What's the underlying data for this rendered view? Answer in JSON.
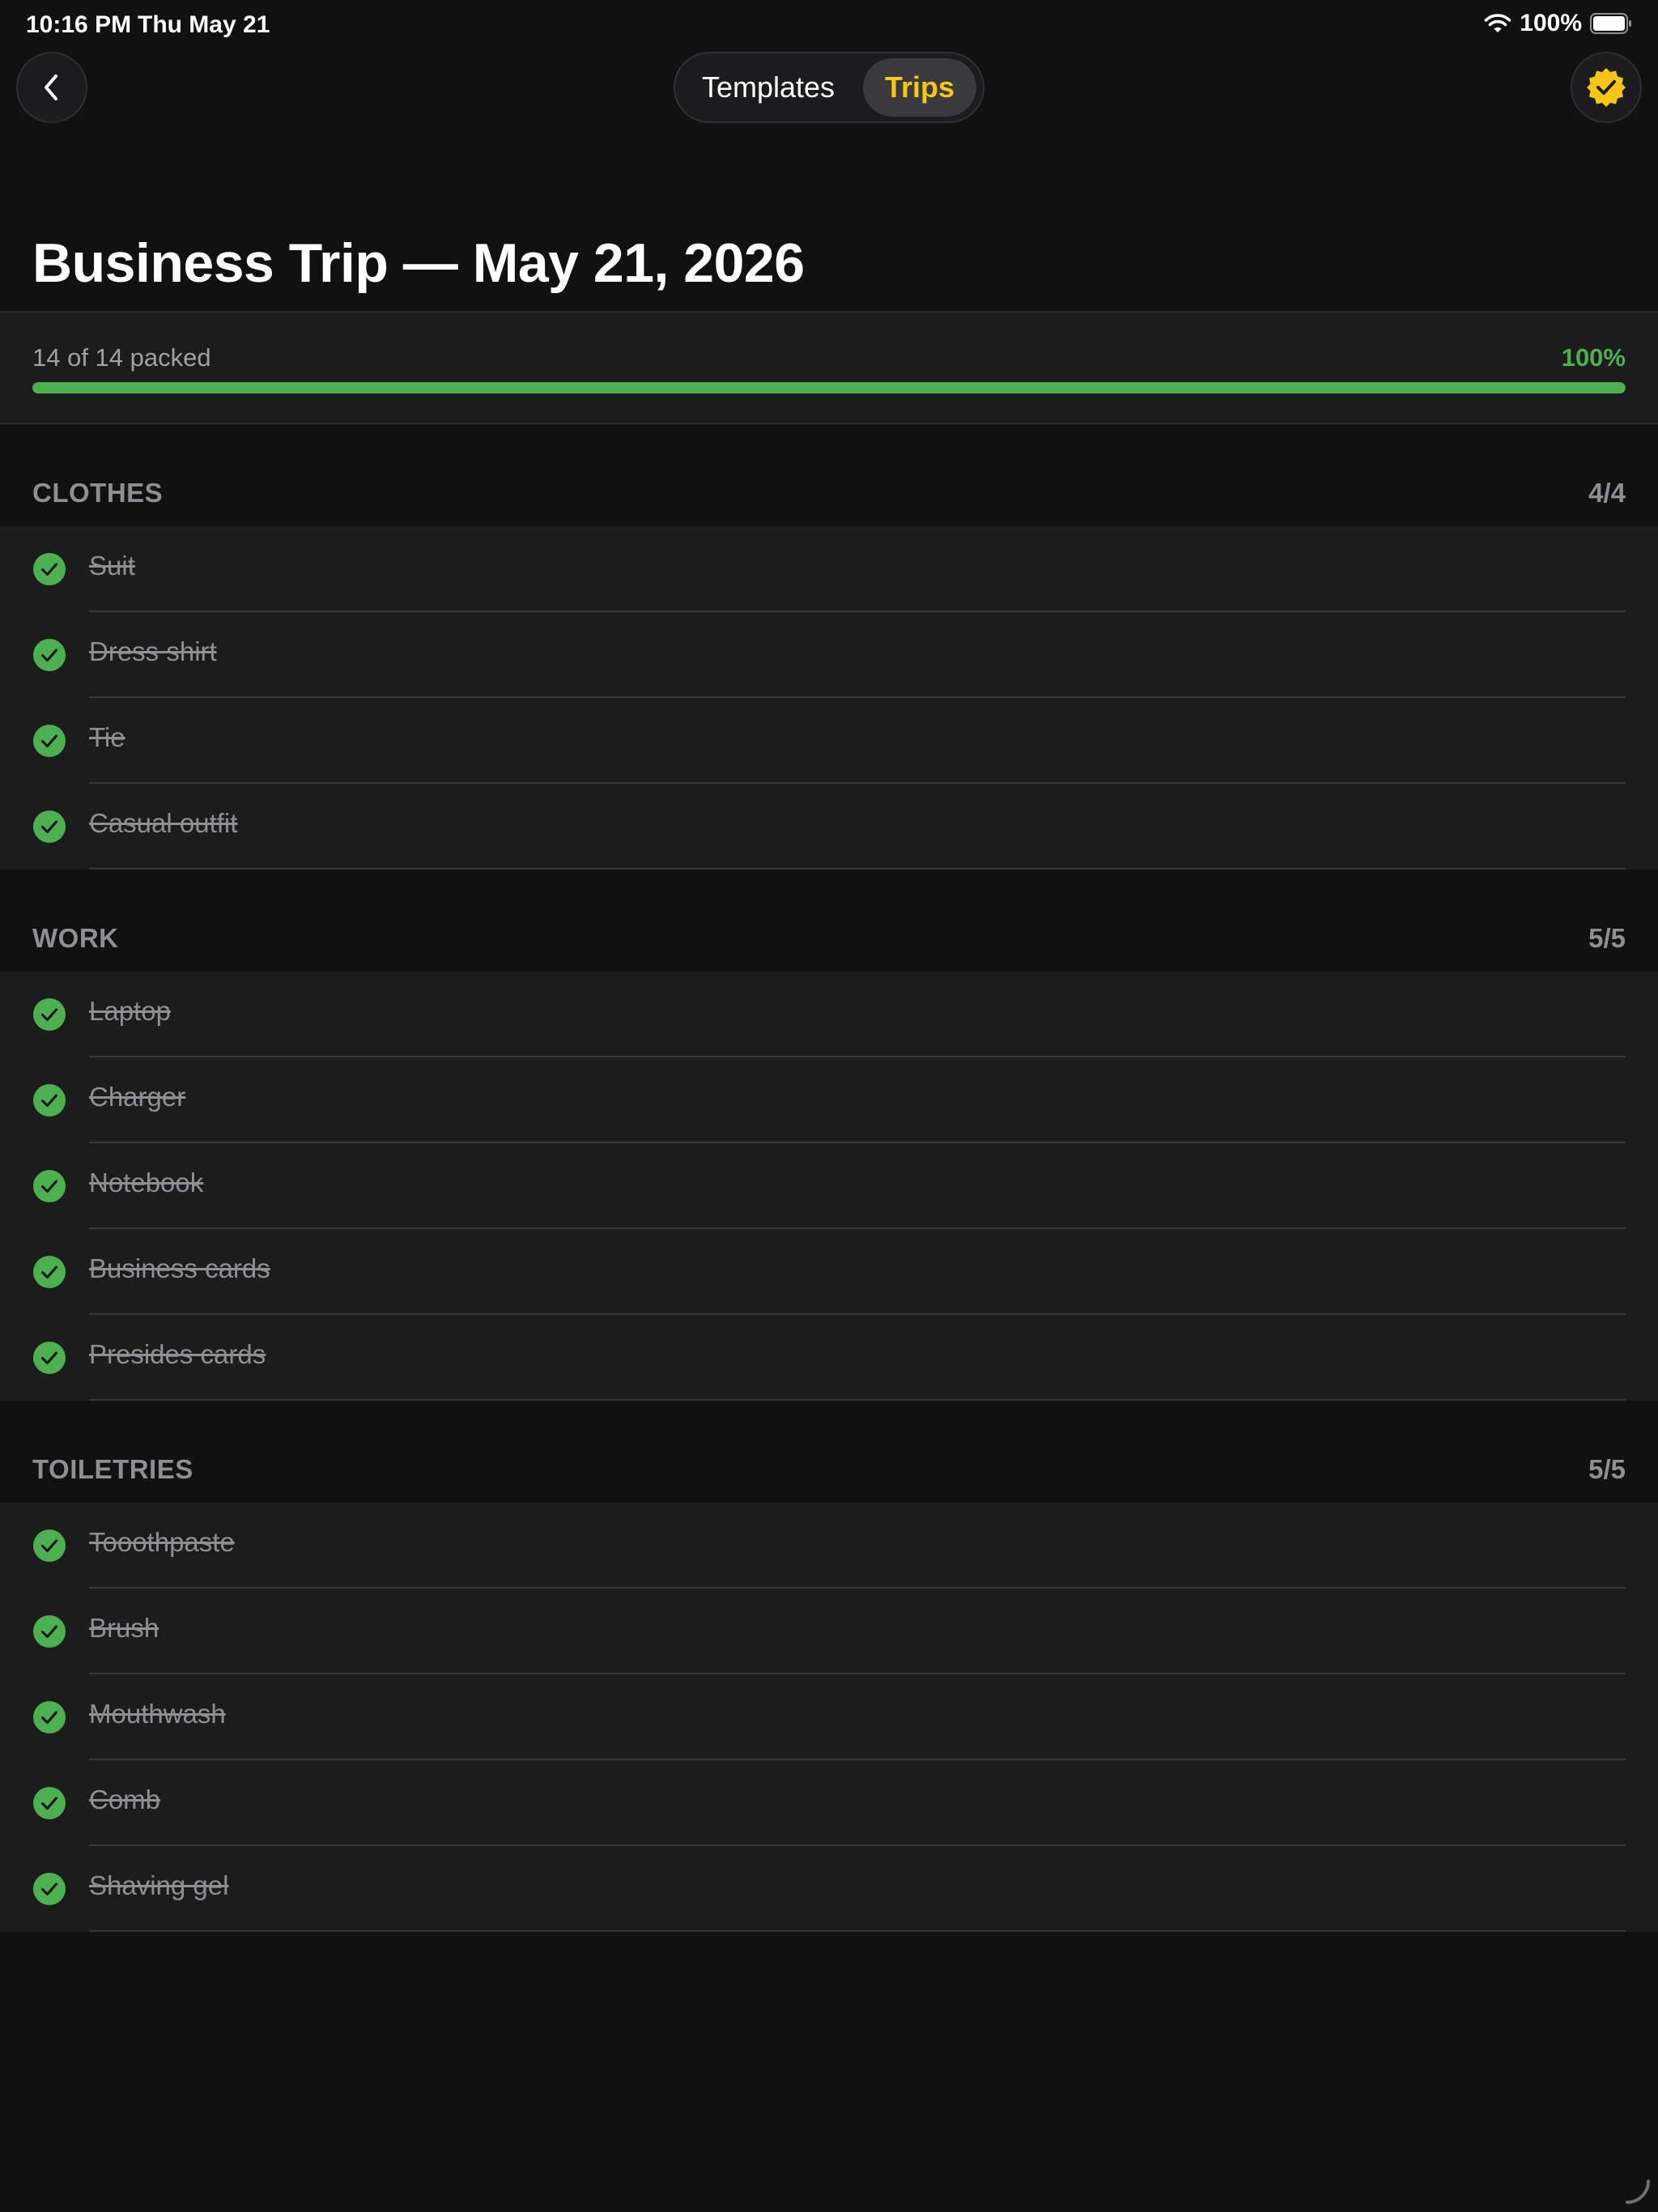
{
  "status_bar": {
    "time": "10:16 PM",
    "date": "Thu May 21",
    "battery_percent": "100%",
    "battery_level": 1.0
  },
  "nav": {
    "back_icon": "chevron-left-icon",
    "segments": [
      {
        "label": "Templates",
        "selected": false
      },
      {
        "label": "Trips",
        "selected": true
      }
    ],
    "badge_icon": "checkmark-seal-icon"
  },
  "page": {
    "title": "Business Trip — May 21, 2026"
  },
  "progress": {
    "text": "14 of 14 packed",
    "percent_label": "100%",
    "fraction": 1.0
  },
  "sections": [
    {
      "title": "CLOTHES",
      "count": "4/4",
      "items": [
        "Suit",
        "Dress shirt",
        "Tie",
        "Casual outfit"
      ]
    },
    {
      "title": "WORK",
      "count": "5/5",
      "items": [
        "Laptop",
        "Charger",
        "Notebook",
        "Business cards",
        "Presides cards"
      ]
    },
    {
      "title": "TOILETRIES",
      "count": "5/5",
      "items": [
        "Tooothpaste",
        "Brush",
        "Mouthwash",
        "Comb",
        "Shaving gel"
      ]
    }
  ],
  "colors": {
    "accent_yellow": "#f5c518",
    "packed_green": "#4caf50",
    "background": "#111112",
    "card": "#1c1c1d",
    "muted_text": "#8e8e93"
  }
}
